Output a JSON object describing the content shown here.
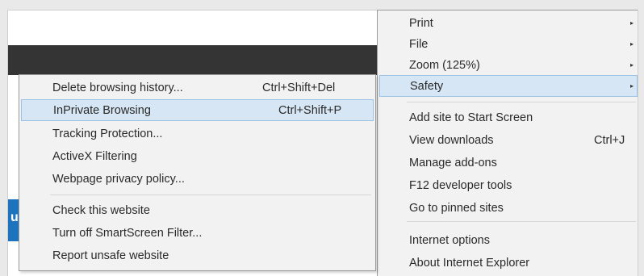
{
  "main_menu": {
    "items": [
      {
        "label": "Print",
        "shortcut": "",
        "submenu": true
      },
      {
        "label": "File",
        "shortcut": "",
        "submenu": true
      },
      {
        "label": "Zoom (125%)",
        "shortcut": "",
        "submenu": true
      },
      {
        "label": "Safety",
        "shortcut": "",
        "submenu": true,
        "highlighted": true
      },
      {
        "label": "Add site to Start Screen",
        "shortcut": ""
      },
      {
        "label": "View downloads",
        "shortcut": "Ctrl+J"
      },
      {
        "label": "Manage add-ons",
        "shortcut": ""
      },
      {
        "label": "F12 developer tools",
        "shortcut": ""
      },
      {
        "label": "Go to pinned sites",
        "shortcut": ""
      },
      {
        "label": "Internet options",
        "shortcut": ""
      },
      {
        "label": "About Internet Explorer",
        "shortcut": ""
      }
    ]
  },
  "safety_submenu": {
    "items": [
      {
        "label": "Delete browsing history...",
        "shortcut": "Ctrl+Shift+Del"
      },
      {
        "label": "InPrivate Browsing",
        "shortcut": "Ctrl+Shift+P",
        "highlighted": true
      },
      {
        "label": "Tracking Protection...",
        "shortcut": ""
      },
      {
        "label": "ActiveX Filtering",
        "shortcut": ""
      },
      {
        "label": "Webpage privacy policy...",
        "shortcut": ""
      },
      {
        "label": "Check this website",
        "shortcut": ""
      },
      {
        "label": "Turn off SmartScreen Filter...",
        "shortcut": ""
      },
      {
        "label": "Report unsafe website",
        "shortcut": ""
      }
    ]
  },
  "background": {
    "edge_glyph": "u"
  },
  "icons": {
    "submenu_arrow": "▸"
  },
  "colors": {
    "highlight_fill": "#d6e6f5",
    "highlight_border": "#9cc2e6",
    "menu_background": "#f2f2f2",
    "accent_blue": "#1e73be"
  }
}
